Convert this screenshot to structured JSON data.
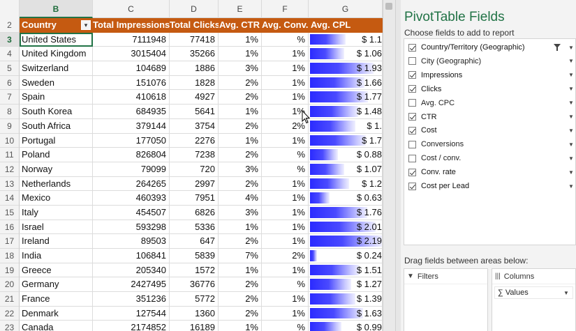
{
  "columns": [
    {
      "letter": "B",
      "active": true
    },
    {
      "letter": "C"
    },
    {
      "letter": "D"
    },
    {
      "letter": "E"
    },
    {
      "letter": "F"
    },
    {
      "letter": "G"
    }
  ],
  "header_row": {
    "row_number": "2",
    "country": "Country",
    "impressions": "Total Impressions",
    "clicks": "Total Clicks",
    "ctr": "Avg. CTR",
    "conv": "Avg. Conv.",
    "cpl": "Avg. CPL",
    "filter_icon": "filter-dropdown-icon"
  },
  "rows": [
    {
      "n": "3",
      "country": "United States",
      "impressions": "7111948",
      "clicks": "77418",
      "ctr": "1%",
      "conv": "%",
      "cpl": "$ 1.1",
      "cpl_value": 1.1
    },
    {
      "n": "4",
      "country": "United Kingdom",
      "impressions": "3015404",
      "clicks": "35266",
      "ctr": "1%",
      "conv": "1%",
      "cpl": "$ 1.06",
      "cpl_value": 1.06
    },
    {
      "n": "5",
      "country": "Switzerland",
      "impressions": "104689",
      "clicks": "1886",
      "ctr": "3%",
      "conv": "1%",
      "cpl": "$ 1.93",
      "cpl_value": 1.93
    },
    {
      "n": "6",
      "country": "Sweden",
      "impressions": "151076",
      "clicks": "1828",
      "ctr": "2%",
      "conv": "1%",
      "cpl": "$ 1.66",
      "cpl_value": 1.66
    },
    {
      "n": "7",
      "country": "Spain",
      "impressions": "410618",
      "clicks": "4927",
      "ctr": "2%",
      "conv": "1%",
      "cpl": "$ 1.77",
      "cpl_value": 1.77
    },
    {
      "n": "8",
      "country": "South Korea",
      "impressions": "684935",
      "clicks": "5641",
      "ctr": "1%",
      "conv": "1%",
      "cpl": "$ 1.48",
      "cpl_value": 1.48
    },
    {
      "n": "9",
      "country": "South Africa",
      "impressions": "379144",
      "clicks": "3754",
      "ctr": "2%",
      "conv": "2%",
      "cpl": "$ 1.",
      "cpl_value": 1.4
    },
    {
      "n": "10",
      "country": "Portugal",
      "impressions": "177050",
      "clicks": "2276",
      "ctr": "1%",
      "conv": "1%",
      "cpl": "$ 1.7",
      "cpl_value": 1.7
    },
    {
      "n": "11",
      "country": "Poland",
      "impressions": "826804",
      "clicks": "7238",
      "ctr": "2%",
      "conv": "%",
      "cpl": "$ 0.88",
      "cpl_value": 0.88
    },
    {
      "n": "12",
      "country": "Norway",
      "impressions": "79099",
      "clicks": "720",
      "ctr": "3%",
      "conv": "%",
      "cpl": "$ 1.07",
      "cpl_value": 1.07
    },
    {
      "n": "13",
      "country": "Netherlands",
      "impressions": "264265",
      "clicks": "2997",
      "ctr": "2%",
      "conv": "1%",
      "cpl": "$ 1.2",
      "cpl_value": 1.2
    },
    {
      "n": "14",
      "country": "Mexico",
      "impressions": "460393",
      "clicks": "7951",
      "ctr": "4%",
      "conv": "1%",
      "cpl": "$ 0.63",
      "cpl_value": 0.63
    },
    {
      "n": "15",
      "country": "Italy",
      "impressions": "454507",
      "clicks": "6826",
      "ctr": "3%",
      "conv": "1%",
      "cpl": "$ 1.76",
      "cpl_value": 1.76
    },
    {
      "n": "16",
      "country": "Israel",
      "impressions": "593298",
      "clicks": "5336",
      "ctr": "1%",
      "conv": "1%",
      "cpl": "$ 2.01",
      "cpl_value": 2.01
    },
    {
      "n": "17",
      "country": "Ireland",
      "impressions": "89503",
      "clicks": "647",
      "ctr": "2%",
      "conv": "1%",
      "cpl": "$ 2.19",
      "cpl_value": 2.19
    },
    {
      "n": "18",
      "country": "India",
      "impressions": "106841",
      "clicks": "5839",
      "ctr": "7%",
      "conv": "2%",
      "cpl": "$ 0.24",
      "cpl_value": 0.24
    },
    {
      "n": "19",
      "country": "Greece",
      "impressions": "205340",
      "clicks": "1572",
      "ctr": "1%",
      "conv": "1%",
      "cpl": "$ 1.51",
      "cpl_value": 1.51
    },
    {
      "n": "20",
      "country": "Germany",
      "impressions": "2427495",
      "clicks": "36776",
      "ctr": "2%",
      "conv": "%",
      "cpl": "$ 1.27",
      "cpl_value": 1.27
    },
    {
      "n": "21",
      "country": "France",
      "impressions": "351236",
      "clicks": "5772",
      "ctr": "2%",
      "conv": "1%",
      "cpl": "$ 1.39",
      "cpl_value": 1.39
    },
    {
      "n": "22",
      "country": "Denmark",
      "impressions": "127544",
      "clicks": "1360",
      "ctr": "2%",
      "conv": "1%",
      "cpl": "$ 1.63",
      "cpl_value": 1.63
    },
    {
      "n": "23",
      "country": "Canada",
      "impressions": "2174852",
      "clicks": "16189",
      "ctr": "1%",
      "conv": "%",
      "cpl": "$ 0.99",
      "cpl_value": 0.99
    }
  ],
  "data_bar_max": 2.19,
  "pane": {
    "title": "PivotTable Fields",
    "subtitle": "Choose fields to add to report",
    "fields": [
      {
        "label": "Country/Territory (Geographic)",
        "checked": true,
        "filtered": true
      },
      {
        "label": "City (Geographic)",
        "checked": false
      },
      {
        "label": "Impressions",
        "checked": true
      },
      {
        "label": "Clicks",
        "checked": true
      },
      {
        "label": "Avg. CPC",
        "checked": false
      },
      {
        "label": "CTR",
        "checked": true
      },
      {
        "label": "Cost",
        "checked": true
      },
      {
        "label": "Conversions",
        "checked": false
      },
      {
        "label": "Cost / conv.",
        "checked": false
      },
      {
        "label": "Conv. rate",
        "checked": true
      },
      {
        "label": "Cost per Lead",
        "checked": true
      }
    ],
    "drag_label": "Drag fields between areas below:",
    "filters_label": "Filters",
    "columns_label": "Columns",
    "values_chip": "∑ Values"
  },
  "colors": {
    "header_fill": "#c55a11",
    "accent": "#217346",
    "bar": "#2b2bff"
  }
}
